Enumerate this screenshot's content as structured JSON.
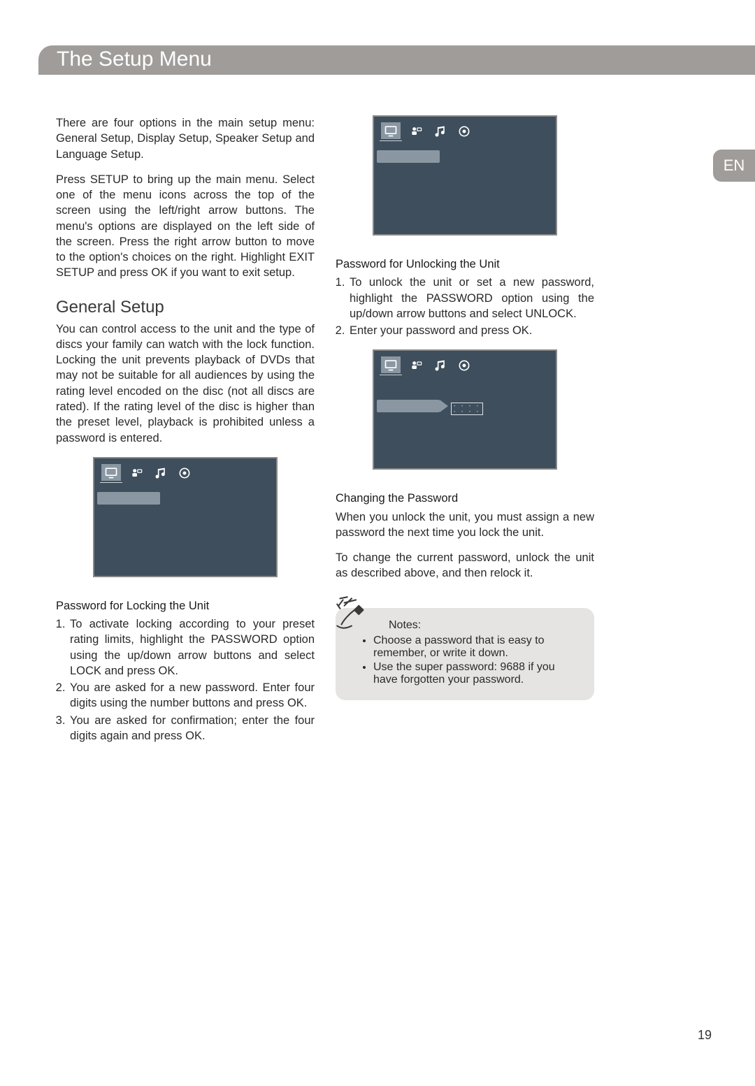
{
  "header": {
    "title": "The Setup Menu"
  },
  "lang_tab": "EN",
  "page_number": "19",
  "left": {
    "intro_p1": "There are four options in the main setup menu: General Setup, Display Setup, Speaker Setup and Language Setup.",
    "intro_p2": "Press SETUP to bring up the main menu. Select one of the menu icons across the top of the screen using the left/right arrow buttons. The menu's options are displayed on the left side of the screen. Press the right arrow button to move to the option's choices on the right. Highlight EXIT SETUP and press OK if you want to exit setup.",
    "general_h": "General Setup",
    "general_p": "You can control access to the unit and the type of discs your family can watch with the lock function. Locking the unit prevents playback of DVDs that may not be suitable for all audiences by using the rating level encoded on the disc (not all discs are rated). If the rating level of the disc is higher than the preset level, playback is prohibited unless a password is entered.",
    "lock_h": "Password for Locking the Unit",
    "lock_steps": [
      "To activate locking according to your preset rating limits, highlight the PASSWORD option using the up/down arrow buttons and select LOCK and press OK.",
      "You are asked for a new password. Enter four digits using the number buttons and press OK.",
      "You are asked for confirmation; enter the four digits again and press OK."
    ]
  },
  "right": {
    "unlock_h": "Password for Unlocking the Unit",
    "unlock_steps": [
      "To unlock the unit or set a new password, highlight the PASSWORD option using the up/down arrow buttons and select UNLOCK.",
      "Enter your password and press OK."
    ],
    "change_h": "Changing the Password",
    "change_p1": "When you unlock the unit, you must assign a new password the next time you lock the unit.",
    "change_p2": "To change the current password, unlock the unit as described above, and then relock it.",
    "notes_title": "Notes:",
    "notes": [
      "Choose a password that is easy to remember, or write it down.",
      "Use the super password: 9688 if you have forgotten your password."
    ]
  },
  "icons": {
    "tv": "tv-icon",
    "people": "people-icon",
    "music": "music-icon",
    "disc": "disc-icon"
  }
}
